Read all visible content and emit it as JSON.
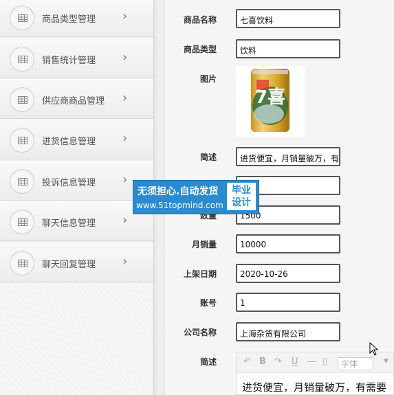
{
  "sidebar": {
    "items": [
      {
        "label": "商品类型管理",
        "icon": "grid-icon"
      },
      {
        "label": "销售统计管理",
        "icon": "grid-icon"
      },
      {
        "label": "供应商商品管理",
        "icon": "grid-icon"
      },
      {
        "label": "进货信息管理",
        "icon": "grid-icon"
      },
      {
        "label": "投诉信息管理",
        "icon": "grid-icon"
      },
      {
        "label": "聊天信息管理",
        "icon": "grid-icon"
      },
      {
        "label": "聊天回复管理",
        "icon": "grid-icon"
      }
    ],
    "chevron": "›"
  },
  "form": {
    "name_label": "商品名称",
    "name_value": "七喜饮料",
    "type_label": "商品类型",
    "type_value": "饮料",
    "image_label": "图片",
    "summary_label": "简述",
    "summary_value": "进货便宜，月销量破万，有需要",
    "price_value": "",
    "quantity_label": "数量",
    "quantity_value": "1500",
    "monthly_sales_label": "月销量",
    "monthly_sales_value": "10000",
    "listed_date_label": "上架日期",
    "listed_date_value": "2020-10-26",
    "account_label": "账号",
    "account_value": "1",
    "company_label": "公司名称",
    "company_value": "上海杂货有限公司",
    "desc_label": "简述",
    "editor": {
      "font_placeholder": "字体",
      "content": "进货便宜，月销量破万，有需要"
    }
  },
  "watermark": {
    "line1": "无须担心.自动发货",
    "line2": "www.51topmind.com",
    "badge_line1": "毕业",
    "badge_line2": "设计",
    "color": "#2a8bd0"
  },
  "product_image": {
    "label": "7喜",
    "accent": "#e8b020"
  }
}
